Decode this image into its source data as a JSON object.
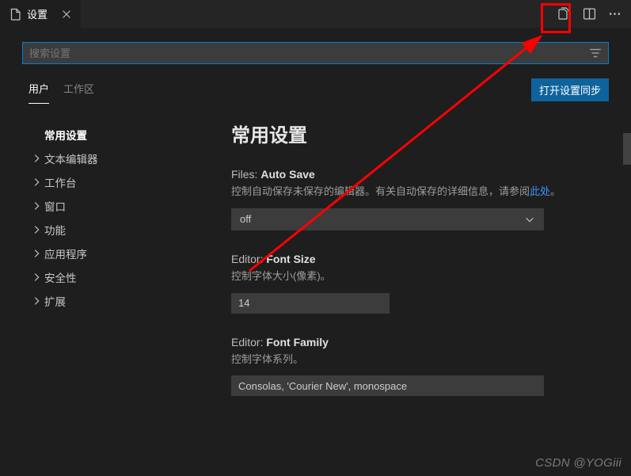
{
  "tab": {
    "title": "设置"
  },
  "search": {
    "placeholder": "搜索设置"
  },
  "scope": {
    "user": "用户",
    "workspace": "工作区"
  },
  "syncButton": "打开设置同步",
  "sidebar": {
    "items": [
      {
        "label": "常用设置",
        "selected": true,
        "expandable": false
      },
      {
        "label": "文本编辑器",
        "selected": false,
        "expandable": true
      },
      {
        "label": "工作台",
        "selected": false,
        "expandable": true
      },
      {
        "label": "窗口",
        "selected": false,
        "expandable": true
      },
      {
        "label": "功能",
        "selected": false,
        "expandable": true
      },
      {
        "label": "应用程序",
        "selected": false,
        "expandable": true
      },
      {
        "label": "安全性",
        "selected": false,
        "expandable": true
      },
      {
        "label": "扩展",
        "selected": false,
        "expandable": true
      }
    ]
  },
  "content": {
    "sectionTitle": "常用设置",
    "settings": {
      "autoSave": {
        "keyPrefix": "Files: ",
        "keyName": "Auto Save",
        "descrPrefix": "控制自动保存未保存的编辑器。有关自动保存的详细信息，请参阅",
        "descrLink": "此处",
        "descrSuffix": "。",
        "value": "off"
      },
      "fontSize": {
        "keyPrefix": "Editor: ",
        "keyName": "Font Size",
        "descr": "控制字体大小(像素)。",
        "value": "14"
      },
      "fontFamily": {
        "keyPrefix": "Editor: ",
        "keyName": "Font Family",
        "descr": "控制字体系列。",
        "value": "Consolas, 'Courier New', monospace"
      }
    }
  },
  "watermark": "CSDN @YOGiii"
}
